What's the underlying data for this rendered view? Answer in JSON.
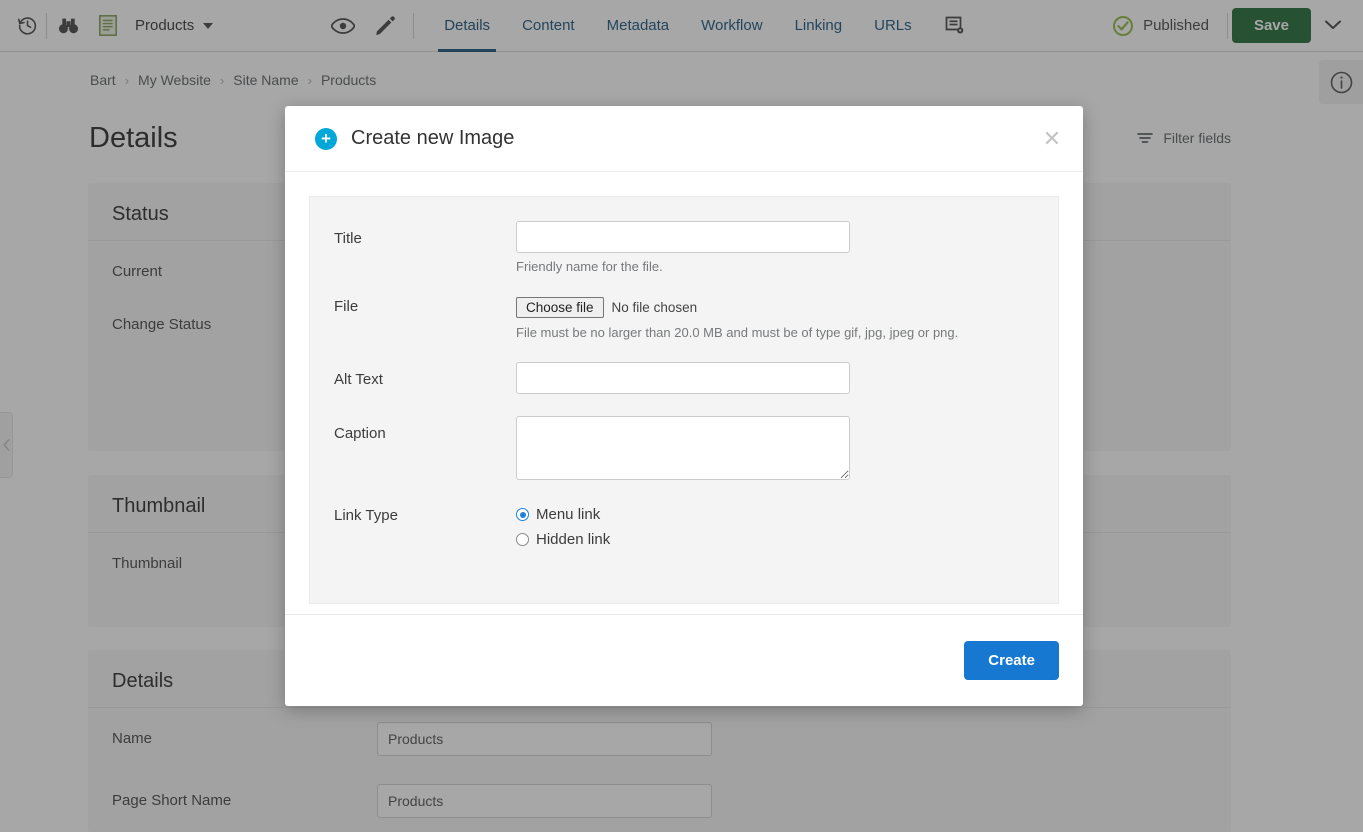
{
  "toolbar": {
    "history_icon": "history-clock-icon",
    "preview_icon": "binoculars-icon",
    "doc_icon": "green-document-icon",
    "context_label": "Products",
    "eye_icon": "eye-icon",
    "pencil_icon": "pencil-icon",
    "settings_icon": "document-settings-icon",
    "tabs": [
      {
        "label": "Details",
        "active": true
      },
      {
        "label": "Content",
        "active": false
      },
      {
        "label": "Metadata",
        "active": false
      },
      {
        "label": "Workflow",
        "active": false
      },
      {
        "label": "Linking",
        "active": false
      },
      {
        "label": "URLs",
        "active": false
      }
    ],
    "status_label": "Published",
    "status_icon": "check-circle-icon",
    "status_color": "#8cb63c",
    "save_label": "Save",
    "save_color": "#14632b",
    "chevron_icon": "chevron-down-icon"
  },
  "breadcrumb": {
    "items": [
      "Bart",
      "My Website",
      "Site Name",
      "Products"
    ],
    "separator": "›"
  },
  "page": {
    "title": "Details",
    "filter_label": "Filter fields",
    "filter_icon": "filter-icon",
    "info_icon": "info-circle-icon",
    "collapse_icon": "chevron-left-icon"
  },
  "cards": [
    {
      "heading": "Status",
      "fields": [
        {
          "label": "Current",
          "value": ""
        },
        {
          "label": "Change Status",
          "value": ""
        }
      ]
    },
    {
      "heading": "Thumbnail",
      "fields": [
        {
          "label": "Thumbnail",
          "value": ""
        }
      ]
    },
    {
      "heading": "Details",
      "fields": [
        {
          "label": "Name",
          "value": "Products"
        },
        {
          "label": "Page Short Name",
          "value": "Products"
        }
      ]
    }
  ],
  "modal": {
    "title": "Create new Image",
    "plus_icon": "plus-circle-icon",
    "plus_color": "#00a7d8",
    "close_icon": "close-icon",
    "fields": {
      "title": {
        "label": "Title",
        "value": "",
        "placeholder": "",
        "help": "Friendly name for the file."
      },
      "file": {
        "label": "File",
        "button_label": "Choose file",
        "chosen_text": "No file chosen",
        "help": "File must be no larger than 20.0 MB and must be of type gif, jpg, jpeg or png."
      },
      "alt_text": {
        "label": "Alt Text",
        "value": "",
        "placeholder": ""
      },
      "caption": {
        "label": "Caption",
        "value": "",
        "placeholder": ""
      },
      "link_type": {
        "label": "Link Type",
        "options": [
          {
            "label": "Menu link",
            "selected": true
          },
          {
            "label": "Hidden link",
            "selected": false
          }
        ]
      }
    },
    "submit_label": "Create",
    "submit_color": "#1678d0"
  }
}
